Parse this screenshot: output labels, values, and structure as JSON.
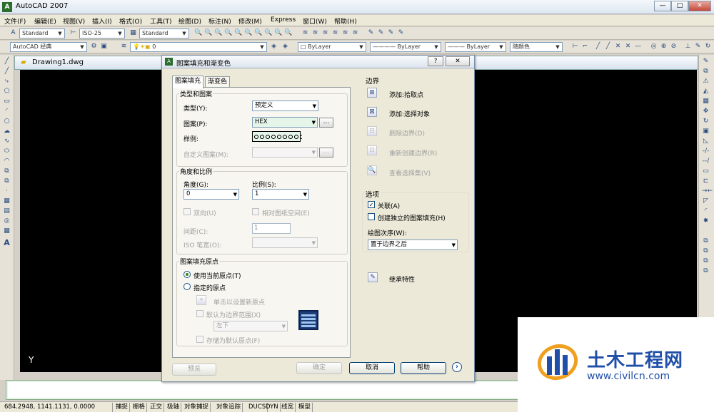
{
  "window": {
    "title": "AutoCAD 2007",
    "btn_min": "—",
    "btn_max": "□",
    "btn_close": "✕"
  },
  "menu": [
    "文件(F)",
    "编辑(E)",
    "视图(V)",
    "插入(I)",
    "格式(O)",
    "工具(T)",
    "绘图(D)",
    "标注(N)",
    "修改(M)",
    "Express",
    "窗口(W)",
    "帮助(H)"
  ],
  "toolbar1": {
    "text_style": "Standard",
    "dim_style": "ISO-25",
    "table_style": "Standard"
  },
  "toolbar2": {
    "workspace": "AutoCAD 经典",
    "layer": "0",
    "color": "ByLayer",
    "linetype": "ByLayer",
    "lineweight": "ByLayer",
    "plotstyle": "随颜色"
  },
  "drawing": {
    "tab_title": "Drawing1.dwg",
    "y_axis": "Y"
  },
  "status": {
    "coords": "684.2948,  1141.1131, 0.0000",
    "buttons": [
      "捕捉",
      "栅格",
      "正交",
      "极轴",
      "对象捕捉",
      "对象追踪",
      "DUCS",
      "DYN",
      "线宽",
      "模型"
    ]
  },
  "watermark": {
    "title": "土木工程网",
    "url": "www.civilcn.com"
  },
  "dialog": {
    "title": "图案填充和渐变色",
    "help_btn": "?",
    "close_btn": "✕",
    "tabs": [
      "图案填充",
      "渐变色"
    ],
    "type_pattern": {
      "group_label": "类型和图案",
      "type_label": "类型(Y):",
      "type_value": "预定义",
      "pattern_label": "图案(P):",
      "pattern_value": "HEX",
      "swatch_label": "样例:",
      "custom_label": "自定义图案(M):",
      "custom_value": ""
    },
    "angle_scale": {
      "group_label": "角度和比例",
      "angle_label": "角度(G):",
      "angle_value": "0",
      "scale_label": "比例(S):",
      "scale_value": "1",
      "double_label": "双向(U)",
      "relative_label": "相对图纸空间(E)",
      "spacing_label": "间距(C):",
      "spacing_value": "1",
      "iso_label": "ISO 笔宽(O):",
      "iso_value": ""
    },
    "origin": {
      "group_label": "图案填充原点",
      "use_current": "使用当前原点(T)",
      "specified": "指定的原点",
      "click_set": "单击以设置新原点",
      "default_extents": "默认为边界范围(X)",
      "extents_value": "左下",
      "store_default": "存储为默认原点(F)"
    },
    "boundary": {
      "label": "边界",
      "add_pick": "添加:拾取点",
      "add_select": "添加:选择对象",
      "remove": "删除边界(D)",
      "recreate": "重新创建边界(R)",
      "view_sel": "查看选择集(V)"
    },
    "options": {
      "label": "选项",
      "associative": "关联(A)",
      "separate": "创建独立的图案填充(H)",
      "draw_order_label": "绘图次序(W):",
      "draw_order_value": "置于边界之后"
    },
    "inherit": "继承特性",
    "buttons": {
      "preview": "预览",
      "ok": "确定",
      "cancel": "取消",
      "help": "帮助",
      "more": "›"
    }
  }
}
